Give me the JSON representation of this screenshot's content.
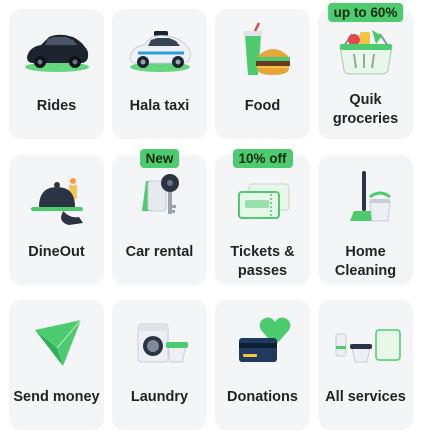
{
  "services": [
    {
      "label": "Rides",
      "icon": "car-icon"
    },
    {
      "label": "Hala taxi",
      "icon": "taxi-icon"
    },
    {
      "label": "Food",
      "icon": "burger-icon"
    },
    {
      "label": "Quik groceries",
      "icon": "grocery-basket-icon",
      "badge": "up to 60%"
    },
    {
      "label": "DineOut",
      "icon": "cloche-icon"
    },
    {
      "label": "Car rental",
      "icon": "car-key-icon",
      "badge": "New"
    },
    {
      "label": "Tickets & passes",
      "icon": "ticket-icon",
      "badge": "10% off"
    },
    {
      "label": "Home Cleaning",
      "icon": "mop-bucket-icon"
    },
    {
      "label": "Send money",
      "icon": "send-arrow-icon"
    },
    {
      "label": "Laundry",
      "icon": "washing-machine-icon"
    },
    {
      "label": "Donations",
      "icon": "heart-card-icon"
    },
    {
      "label": "All services",
      "icon": "more-services-icon"
    }
  ],
  "colors": {
    "accent": "#4ccc6e",
    "tile": "#f4f5f7",
    "text": "#1d2327"
  }
}
